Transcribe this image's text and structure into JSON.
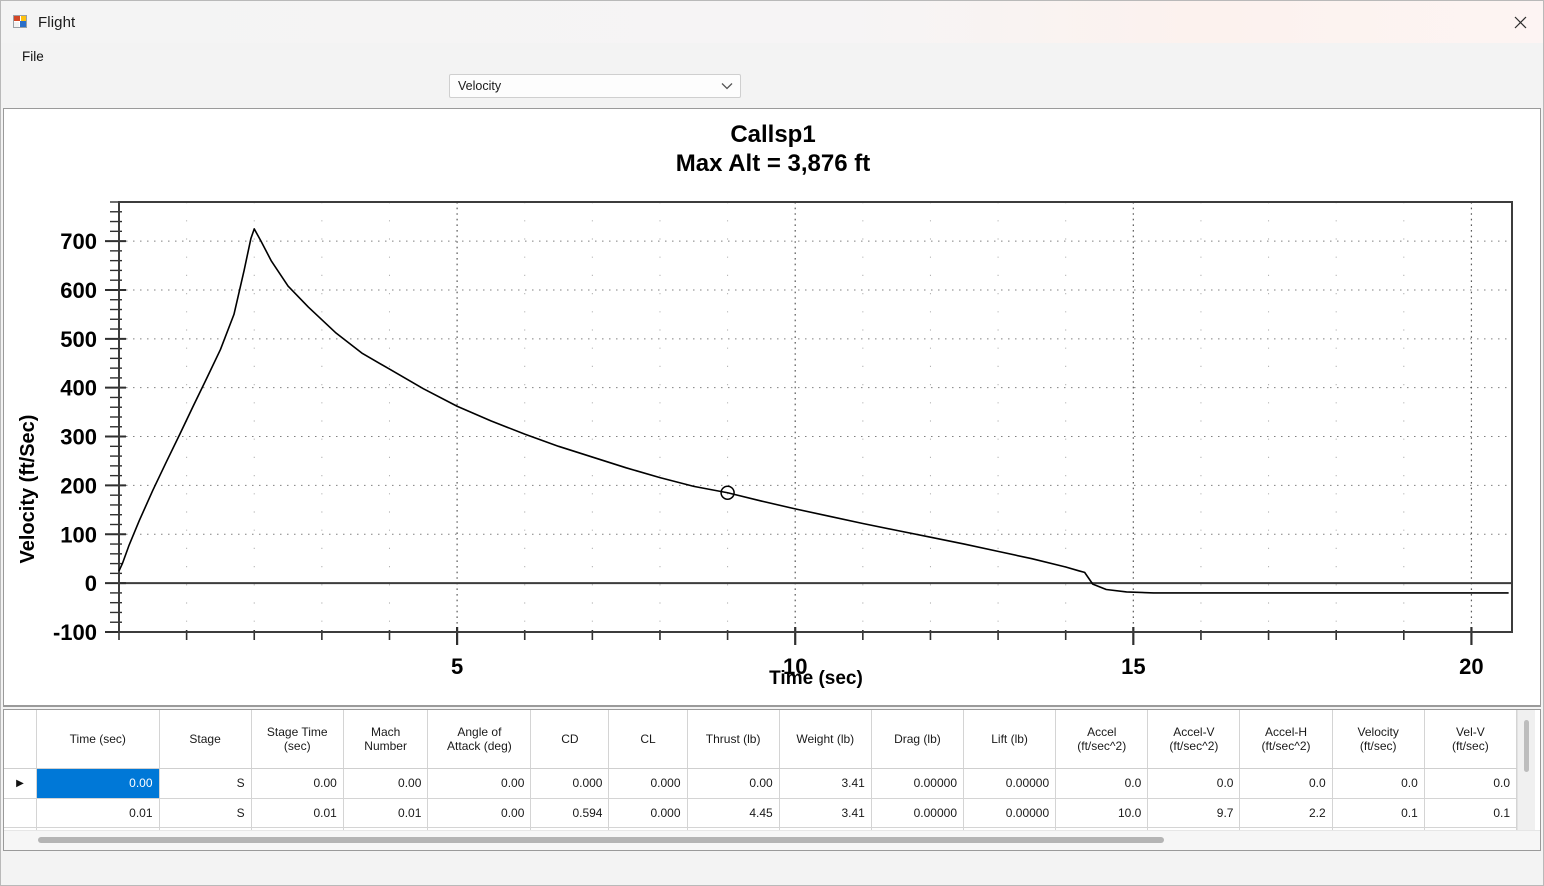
{
  "window": {
    "title": "Flight",
    "app_icon": "form-icon",
    "close_label": "close-icon"
  },
  "menu": {
    "items": [
      {
        "label": "File"
      }
    ]
  },
  "toolbar": {
    "plot_select": {
      "value": "Velocity",
      "arrow_icon": "chevron-down-icon",
      "options": [
        "Velocity"
      ]
    }
  },
  "chart_data": {
    "type": "line",
    "title": "Callsp1",
    "subtitle": "Max Alt = 3,876 ft",
    "xlabel": "Time (sec)",
    "ylabel": "Velocity (ft/Sec)",
    "xlim": [
      0,
      20.6
    ],
    "ylim": [
      -100,
      780
    ],
    "xticks": [
      5,
      10,
      15,
      20
    ],
    "xtick_labels": [
      "5",
      "10",
      "15",
      "20"
    ],
    "yticks": [
      -100,
      0,
      100,
      200,
      300,
      400,
      500,
      600,
      700
    ],
    "ytick_labels": [
      "-100",
      "0",
      "100",
      "200",
      "300",
      "400",
      "500",
      "600",
      "700"
    ],
    "y_minor_step": 20,
    "x_minor_step": 1,
    "grid": true,
    "grid_style": "dotted",
    "zero_line": true,
    "legend": "none",
    "series": [
      {
        "name": "Velocity",
        "color": "#000000",
        "marker_point": {
          "x": 9.0,
          "y": 185,
          "marker": "circle"
        },
        "x": [
          0.0,
          0.05,
          0.15,
          0.3,
          0.5,
          0.7,
          0.9,
          1.1,
          1.3,
          1.5,
          1.7,
          1.85,
          1.95,
          2.0,
          2.1,
          2.25,
          2.5,
          2.8,
          3.2,
          3.6,
          4.0,
          4.5,
          5.0,
          5.5,
          6.0,
          6.5,
          7.0,
          7.5,
          8.0,
          8.5,
          9.0,
          9.5,
          10.0,
          10.5,
          11.0,
          11.5,
          12.0,
          12.5,
          13.0,
          13.5,
          14.0,
          14.2,
          14.28,
          14.4,
          14.6,
          14.9,
          15.3,
          16.0,
          17.0,
          18.0,
          19.0,
          20.0,
          20.55
        ],
        "y": [
          25,
          40,
          78,
          128,
          190,
          248,
          305,
          363,
          420,
          478,
          550,
          640,
          705,
          725,
          700,
          660,
          608,
          565,
          513,
          470,
          438,
          398,
          362,
          332,
          305,
          280,
          258,
          236,
          216,
          198,
          185,
          168,
          152,
          137,
          122,
          108,
          94,
          80,
          65,
          50,
          33,
          25,
          22,
          -2,
          -13,
          -18,
          -20,
          -20,
          -20,
          -20,
          -20,
          -20,
          -20
        ]
      }
    ]
  },
  "table": {
    "columns": [
      {
        "header": "Time (sec)"
      },
      {
        "header": "Stage"
      },
      {
        "header": "Stage Time\n(sec)"
      },
      {
        "header": "Mach\nNumber"
      },
      {
        "header": "Angle of\nAttack (deg)"
      },
      {
        "header": "CD"
      },
      {
        "header": "CL"
      },
      {
        "header": "Thrust (lb)"
      },
      {
        "header": "Weight (lb)"
      },
      {
        "header": "Drag (lb)"
      },
      {
        "header": "Lift (lb)"
      },
      {
        "header": "Accel\n(ft/sec^2)"
      },
      {
        "header": "Accel-V\n(ft/sec^2)"
      },
      {
        "header": "Accel-H\n(ft/sec^2)"
      },
      {
        "header": "Velocity\n(ft/sec)"
      },
      {
        "header": "Vel-V\n(ft/sec)"
      }
    ],
    "rows": [
      {
        "selected": true,
        "row_indicator": "▶",
        "cells": [
          "0.00",
          "S",
          "0.00",
          "0.00",
          "0.00",
          "0.000",
          "0.000",
          "0.00",
          "3.41",
          "0.00000",
          "0.00000",
          "0.0",
          "0.0",
          "0.0",
          "0.0",
          "0.0"
        ]
      },
      {
        "selected": false,
        "row_indicator": "",
        "cells": [
          "0.01",
          "S",
          "0.01",
          "0.01",
          "0.00",
          "0.594",
          "0.000",
          "4.45",
          "3.41",
          "0.00000",
          "0.00000",
          "10.0",
          "9.7",
          "2.2",
          "0.1",
          "0.1"
        ]
      }
    ]
  },
  "colors": {
    "selection": "#0078d7",
    "plot_line": "#000000",
    "grid": "#808080",
    "axis": "#3c3c3c"
  }
}
